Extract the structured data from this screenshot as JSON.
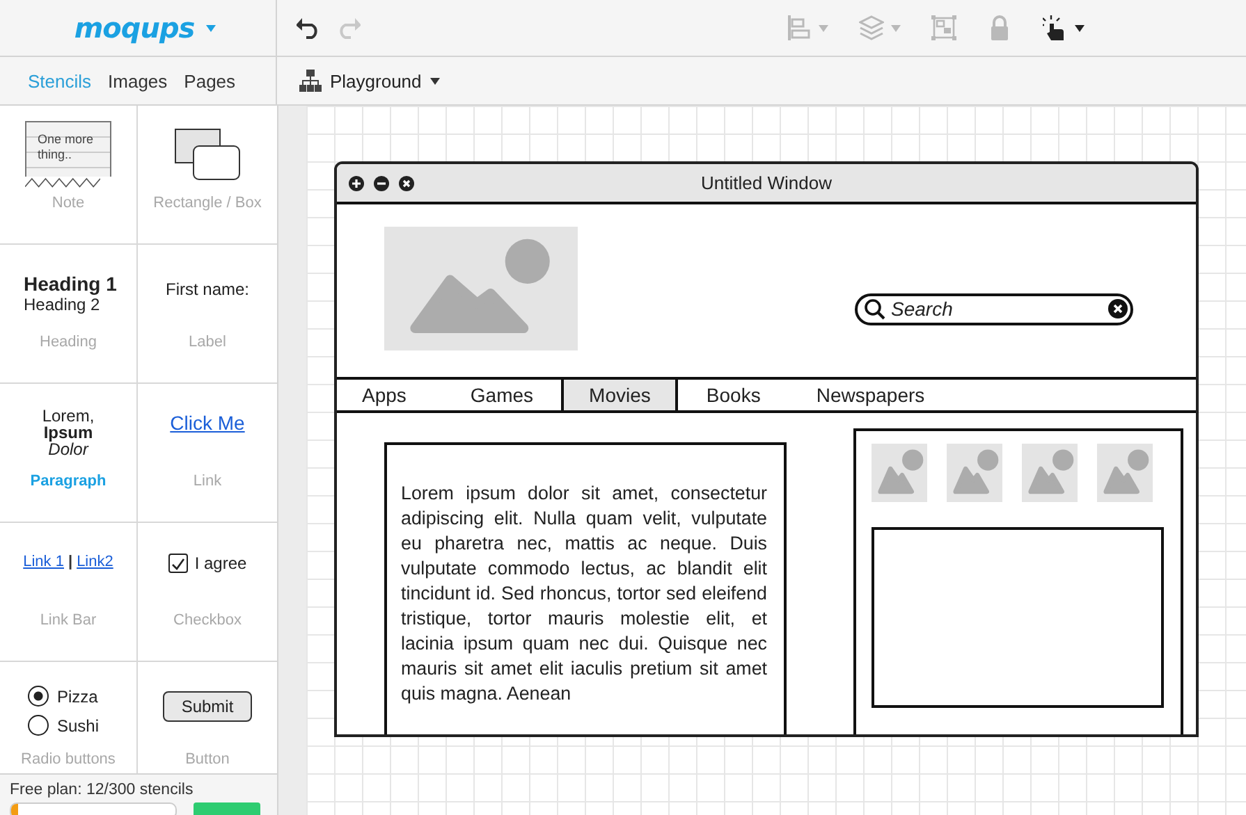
{
  "app": {
    "logo": "moqups"
  },
  "toolbar": {
    "undo": {
      "disabled": false
    },
    "redo": {
      "disabled": true
    },
    "tools": [
      {
        "kind": "align",
        "disabled": true,
        "menu": true
      },
      {
        "kind": "layers",
        "disabled": true,
        "menu": true
      },
      {
        "kind": "group",
        "disabled": true,
        "menu": false
      },
      {
        "kind": "lock",
        "disabled": true,
        "menu": false
      },
      {
        "kind": "interact",
        "disabled": false,
        "menu": true
      }
    ]
  },
  "sidebar": {
    "tabs": [
      {
        "label": "Stencils",
        "selected": true
      },
      {
        "label": "Images",
        "selected": false
      },
      {
        "label": "Pages",
        "selected": false
      }
    ],
    "stencils": [
      {
        "kind": "note",
        "preview": [
          "One more",
          "thing.."
        ],
        "label": "Note",
        "selected": false
      },
      {
        "kind": "rectangle",
        "label": "Rectangle / Box",
        "selected": false
      },
      {
        "kind": "heading",
        "preview": [
          "Heading 1",
          "Heading 2"
        ],
        "label": "Heading",
        "selected": false
      },
      {
        "kind": "label",
        "preview": [
          "First name:"
        ],
        "label": "Label",
        "selected": false
      },
      {
        "kind": "paragraph",
        "preview": [
          "Lorem,",
          "Ipsum",
          "Dolor"
        ],
        "label": "Paragraph",
        "selected": true
      },
      {
        "kind": "link",
        "preview": [
          "Click Me"
        ],
        "label": "Link",
        "selected": false
      },
      {
        "kind": "linkbar",
        "preview": [
          "Link 1",
          "|",
          "Link2"
        ],
        "label": "Link Bar",
        "selected": false
      },
      {
        "kind": "checkbox",
        "preview": [
          "I agree"
        ],
        "checked": true,
        "label": "Checkbox",
        "selected": false
      },
      {
        "kind": "radio",
        "options": [
          {
            "label": "Pizza",
            "selected": true
          },
          {
            "label": "Sushi",
            "selected": false
          }
        ],
        "label": "Radio buttons",
        "selected": false
      },
      {
        "kind": "button",
        "preview": [
          "Submit"
        ],
        "label": "Button",
        "selected": false
      }
    ],
    "plan": "Free plan: 12/300 stencils",
    "usage": {
      "level": 0.04
    }
  },
  "canvas": {
    "page": "Playground",
    "window": {
      "title": "Untitled Window",
      "search": {
        "placeholder": "Search"
      },
      "tabs": [
        {
          "label": "Apps",
          "selected": false
        },
        {
          "label": "Games",
          "selected": false
        },
        {
          "label": "Movies",
          "selected": true
        },
        {
          "label": "Books",
          "selected": false
        },
        {
          "label": "Newspapers",
          "selected": false
        }
      ],
      "paragraph": "Lorem ipsum dolor sit amet, consectetur adipiscing elit. Nulla quam velit, vulputate eu pharetra nec, mattis ac neque. Duis vulputate commodo lectus, ac blandit elit tincidunt id. Sed rhoncus, tortor sed eleifend tristique, tortor mauris molestie elit, et lacinia ipsum quam nec dui. Quisque nec mauris sit amet elit iaculis pretium sit amet quis magna. Aenean"
    }
  }
}
